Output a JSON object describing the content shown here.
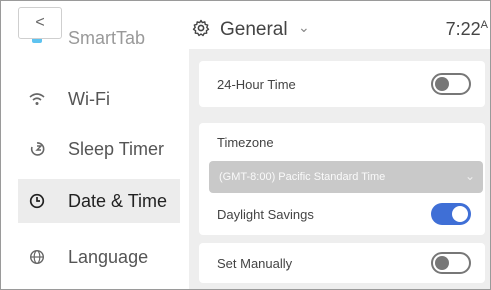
{
  "sidebar": {
    "back_label": "<",
    "partial_label": "SmartTab",
    "items": [
      {
        "label": "Wi-Fi",
        "icon": "wifi-icon",
        "active": false
      },
      {
        "label": "Sleep Timer",
        "icon": "sleep-timer-icon",
        "active": false
      },
      {
        "label": "Date & Time",
        "icon": "clock-icon",
        "active": true
      },
      {
        "label": "Language",
        "icon": "globe-icon",
        "active": false
      }
    ]
  },
  "header": {
    "title": "General",
    "time": "7:22",
    "time_suffix": "A"
  },
  "settings": {
    "hour24": {
      "label": "24-Hour Time",
      "enabled": false
    },
    "timezone": {
      "label": "Timezone",
      "value": "(GMT-8:00) Pacific Standard Time"
    },
    "daylight": {
      "label": "Daylight Savings",
      "enabled": true
    },
    "manual": {
      "label": "Set Manually",
      "enabled": false
    }
  },
  "colors": {
    "accent": "#3f6fd6",
    "active_bg": "#ececec",
    "panel_bg": "#eeeeee"
  }
}
